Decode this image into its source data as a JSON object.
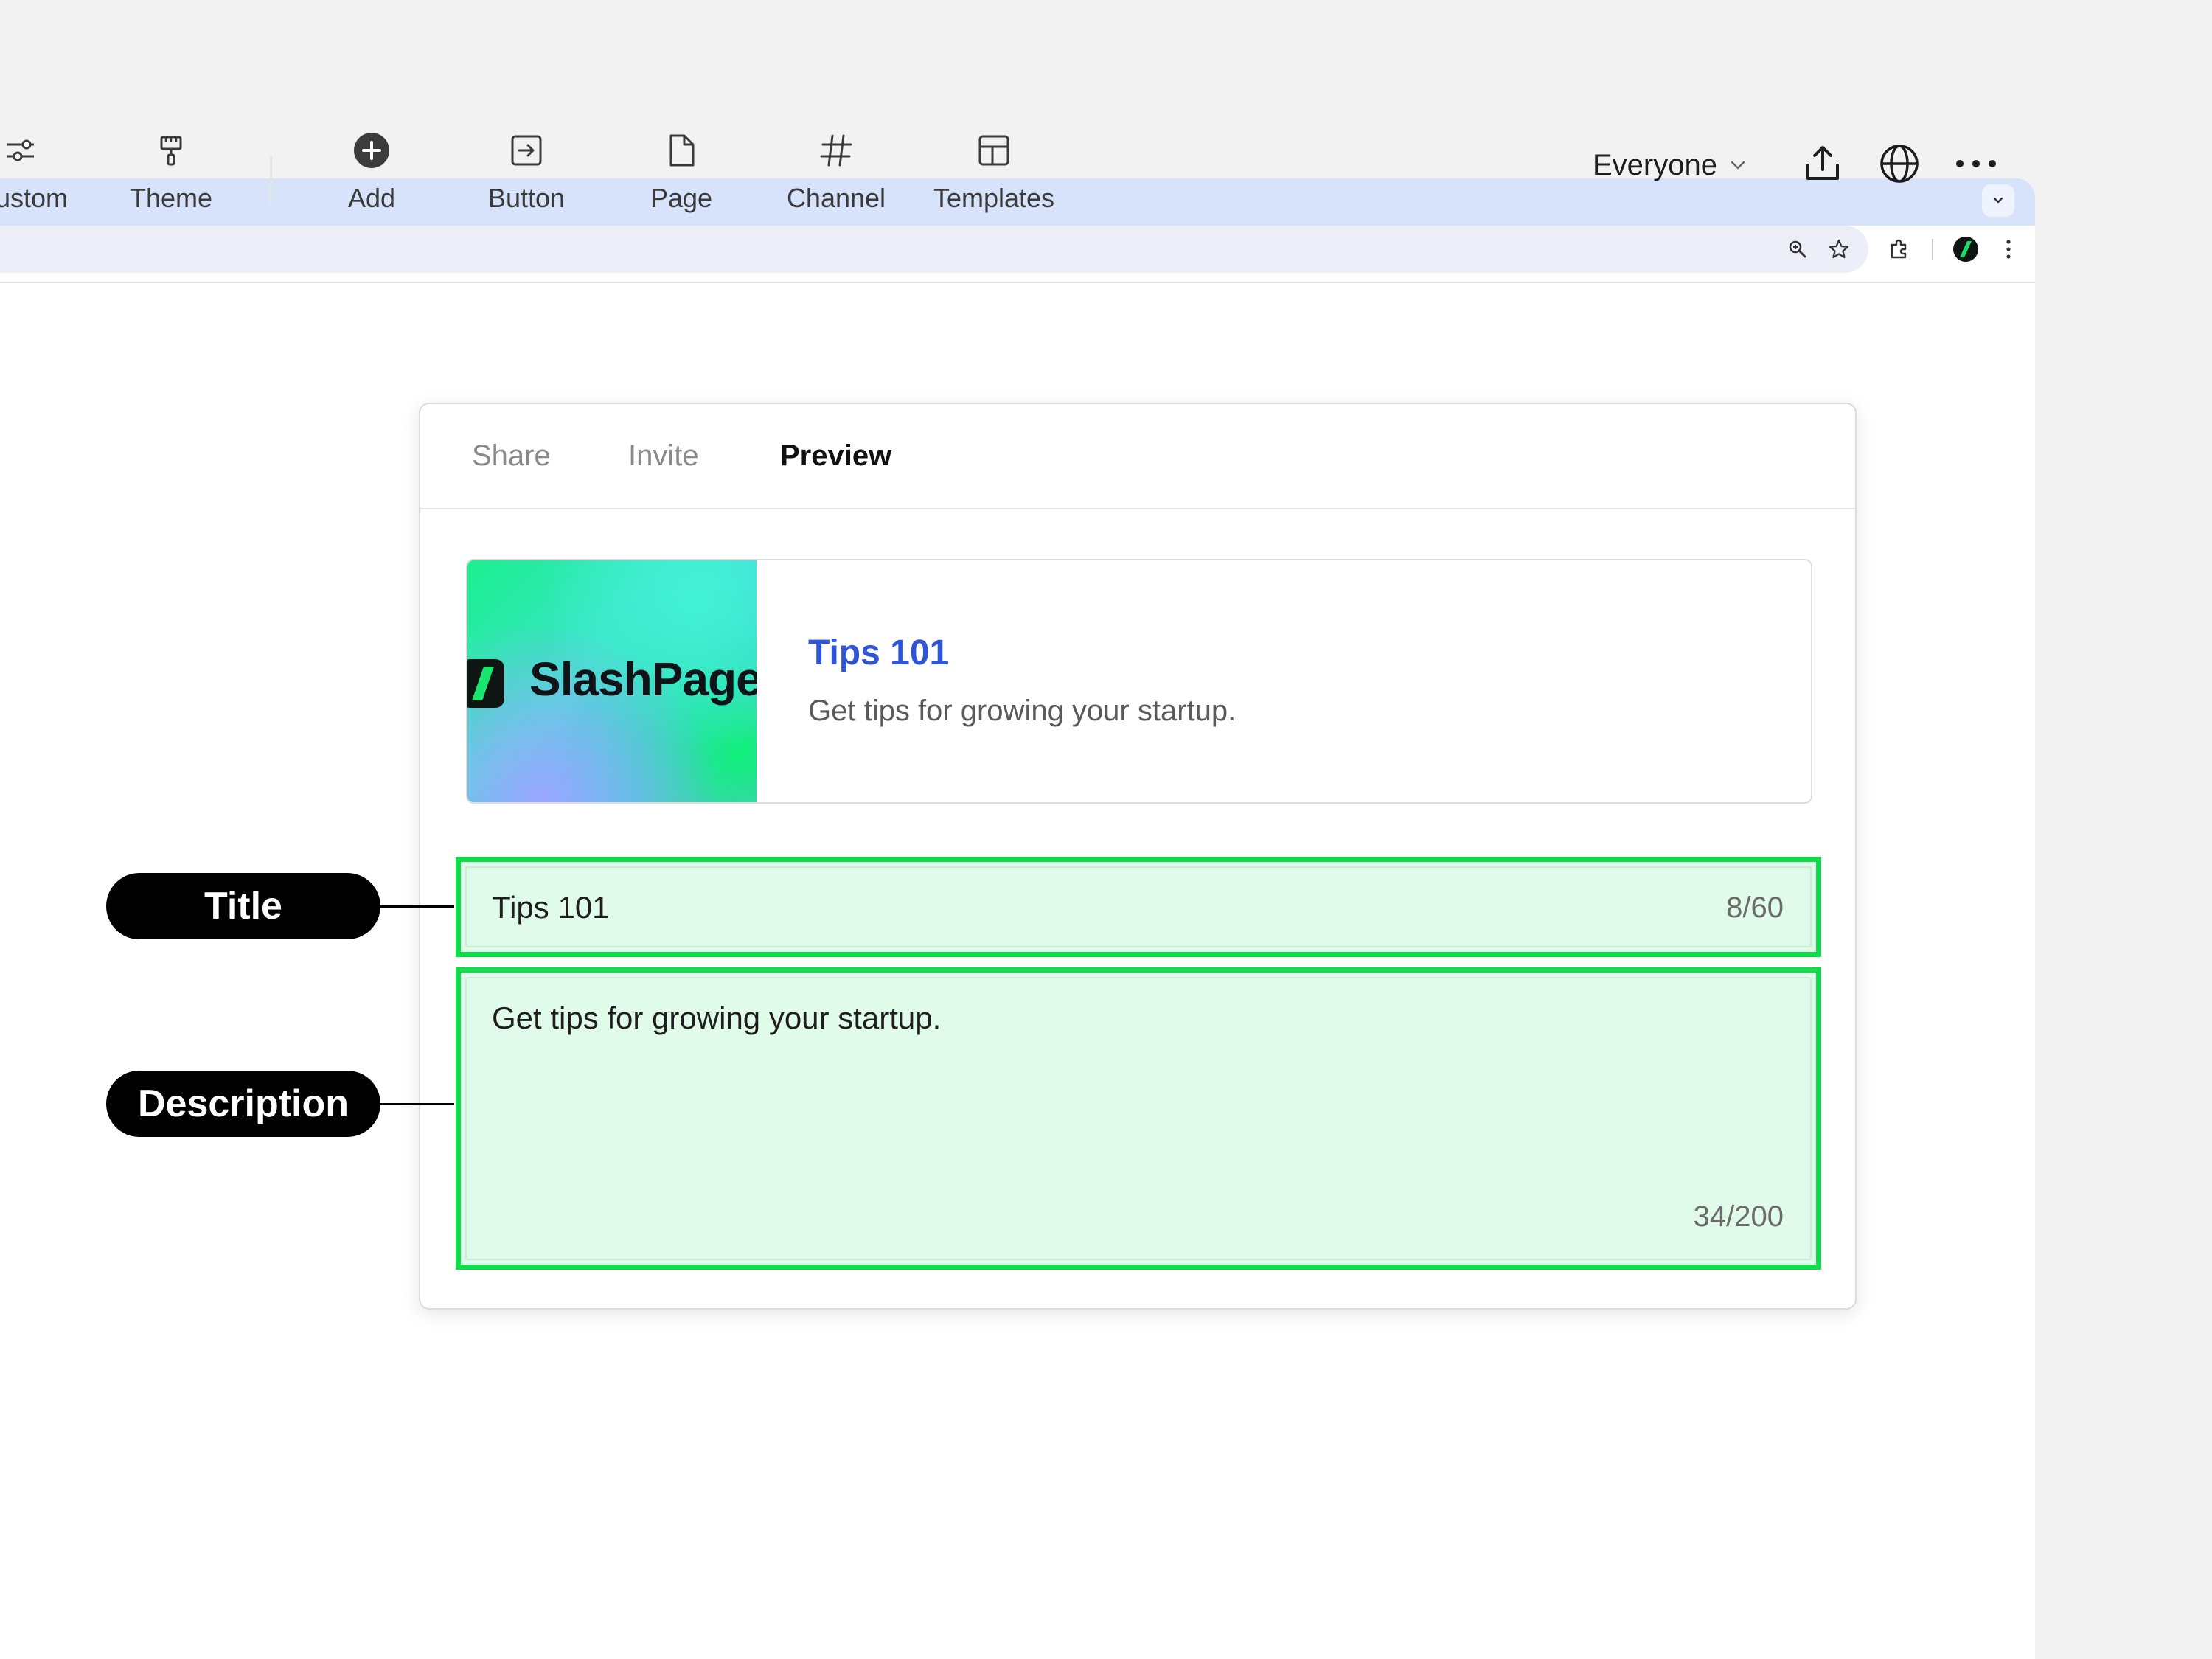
{
  "browser": {
    "icons": [
      "chevron-down-icon",
      "zoom-icon",
      "star-icon",
      "extensions-icon",
      "profile-avatar-icon",
      "kebab-menu-icon"
    ]
  },
  "toolbar": {
    "items": [
      {
        "label": "Custom",
        "icon": "sliders-icon"
      },
      {
        "label": "Theme",
        "icon": "paint-roller-icon"
      },
      {
        "label": "Add",
        "icon": "plus-circle-icon"
      },
      {
        "label": "Button",
        "icon": "button-arrow-icon"
      },
      {
        "label": "Page",
        "icon": "page-icon"
      },
      {
        "label": "Channel",
        "icon": "hash-icon"
      },
      {
        "label": "Templates",
        "icon": "templates-icon"
      }
    ],
    "audience": "Everyone",
    "right_icons": [
      "share-upload-icon",
      "globe-icon",
      "more-icon"
    ]
  },
  "popover": {
    "tabs": [
      {
        "label": "Share",
        "active": false
      },
      {
        "label": "Invite",
        "active": false
      },
      {
        "label": "Preview",
        "active": true
      }
    ],
    "preview": {
      "brand": "SlashPage",
      "title": "Tips 101",
      "description": "Get tips for growing your startup."
    },
    "title_field": {
      "value": "Tips 101",
      "counter": "8/60"
    },
    "description_field": {
      "value": "Get tips for growing your startup.",
      "counter": "34/200"
    }
  },
  "callouts": {
    "title": "Title",
    "description": "Description"
  },
  "colors": {
    "highlight": "#11dc4a",
    "highlight_fill": "#e0fbea",
    "link_title": "#2f55d4",
    "tabstrip": "#d6e3fb"
  }
}
